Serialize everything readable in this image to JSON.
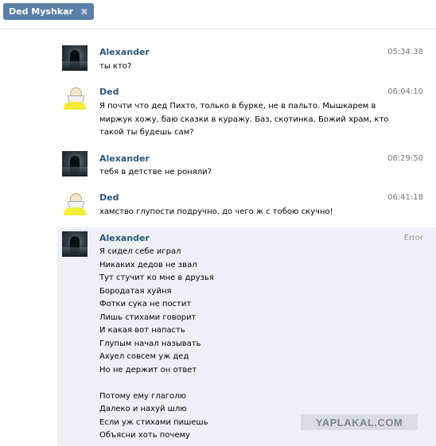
{
  "tab": {
    "label": "Ded Myshkar",
    "close_glyph": "✖"
  },
  "messages": [
    {
      "author": "Alexander",
      "time": "05:34:38",
      "avatar": "dark-figure-avatar",
      "text": "ты кто?"
    },
    {
      "author": "Ded",
      "time": "06:04:10",
      "avatar": "old-man-cartoon-avatar",
      "text": "Я почти что дед Пихто, только в бурке, не в пальто. Мышкарем в\nмиржук хожу, баю сказки в куражу. Баз, скотинка, Божий храм, кто\nтакой ты будешь сам?"
    },
    {
      "author": "Alexander",
      "time": "06:29:50",
      "avatar": "dark-figure-avatar",
      "text": "тебя в детстве не роняли?"
    },
    {
      "author": "Ded",
      "time": "06:41:18",
      "avatar": "old-man-cartoon-avatar",
      "text": "хамство глупости подручно. до чего ж с тобою скучно!"
    },
    {
      "author": "Alexander",
      "time": "Error",
      "avatar": "dark-figure-avatar",
      "text": "Я сидел себе играл\nНикаких дедов не звал\nТут стучит ко мне в друзья\nБородатая хуйня\nФотки сука не постит\nЛишь стихами говорит\nИ какая вот напасть\nГлупым начал называть\nАхуел совсем уж дед\nНо не держит он ответ\n\nПотому ему глаголю\nДалеко и нахуй шлю\nЕсли уж стихами пишешь\nОбъясни хоть почему"
    }
  ],
  "watermark": "YAPLAKAL.COM",
  "colors": {
    "tab_bg": "#5b7fa6",
    "author": "#2b587a",
    "highlight": "#edf1f5"
  }
}
